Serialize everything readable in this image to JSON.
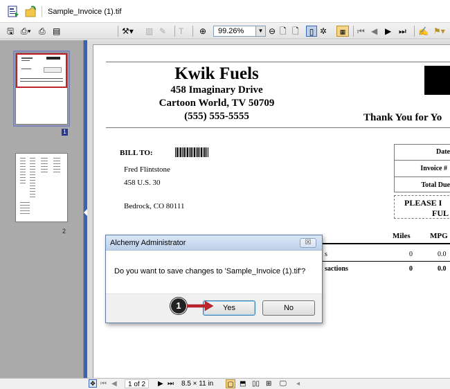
{
  "address_bar": {
    "filename": "Sample_Invoice (1).tif"
  },
  "toolbar": {
    "zoom_value": "99.26%"
  },
  "thumbnails": [
    {
      "page_label": "1"
    },
    {
      "page_label": "2"
    }
  ],
  "invoice": {
    "company": "Kwik Fuels",
    "address1": "458 Imaginary Drive",
    "address2": "Cartoon World, TV 50709",
    "phone": "(555) 555-5555",
    "thank_you": "Thank You for Yo",
    "bill_to_label": "BILL TO:",
    "customer_name": "Fred Flintstone",
    "customer_street": "458 U.S. 30",
    "customer_city": "Bedrock, CO 80111",
    "date_label": "Date",
    "invoice_no_label": "Invoice #",
    "total_due_label": "Total Due",
    "please_text": "PLEASE I",
    "full_text": "FUL",
    "col_miles": "Miles",
    "col_mpg": "MPG",
    "row1_tail": "s",
    "row1_miles": "0",
    "row1_mpg": "0.0",
    "row2_tail": "sactions",
    "row2_miles": "0",
    "row2_mpg": "0.0"
  },
  "status_bar": {
    "page_indicator": "1 of 2",
    "page_size": "8.5 × 11 in"
  },
  "dialog": {
    "title": "Alchemy Administrator",
    "message": "Do you want to save changes to 'Sample_Invoice (1).tif'?",
    "yes_label": "Yes",
    "no_label": "No",
    "close_glyph": "☒"
  },
  "callout": {
    "number": "1"
  },
  "colors": {
    "accent": "#3a62b8",
    "callout_arrow": "#c0232b",
    "thumb_highlight": "#c0232b"
  }
}
